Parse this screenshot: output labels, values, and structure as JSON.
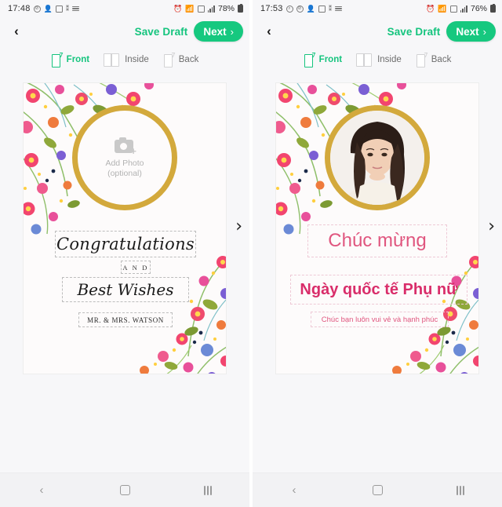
{
  "screens": [
    {
      "id": "front-template",
      "status_bar": {
        "time": "17:48",
        "battery": "78%",
        "icons_left": [
          "do-not-disturb-icon",
          "contacts-icon",
          "gallery-icon",
          "bluetooth-share-icon",
          "menu-lines-icon"
        ],
        "icons_right": [
          "alarm-icon",
          "wifi-icon",
          "data-saver-icon",
          "signal-bars-icon"
        ]
      },
      "app_bar": {
        "back_label": "‹",
        "save_draft_label": "Save Draft",
        "next_label": "Next",
        "next_chevron": "›"
      },
      "tabs": [
        {
          "label": "Front",
          "icon": "card-front-icon",
          "active": true
        },
        {
          "label": "Inside",
          "icon": "card-inside-icon",
          "active": false
        },
        {
          "label": "Back",
          "icon": "card-back-icon",
          "active": false
        }
      ],
      "card": {
        "photo_placeholder": {
          "icon": "add-photo-camera-icon",
          "line1": "Add Photo",
          "line2": "(optional)",
          "has_photo": false
        },
        "text_blocks": [
          {
            "name": "greeting",
            "text": "Congratulations"
          },
          {
            "name": "connector",
            "text": "A N D"
          },
          {
            "name": "subgreeting",
            "text": "Best Wishes"
          },
          {
            "name": "signature",
            "text": "MR. & MRS. WATSON"
          }
        ]
      },
      "carousel_next": "›",
      "nav_bar": {
        "back": "‹",
        "home": "home-square-icon",
        "recents": "recents-icon"
      }
    },
    {
      "id": "womens-day-template",
      "status_bar": {
        "time": "17:53",
        "battery": "76%",
        "icons_left": [
          "search-icon",
          "do-not-disturb-icon",
          "contacts-icon",
          "gallery-icon",
          "bluetooth-share-icon",
          "menu-lines-icon"
        ],
        "icons_right": [
          "alarm-icon",
          "wifi-icon",
          "data-saver-icon",
          "signal-bars-icon"
        ]
      },
      "app_bar": {
        "back_label": "‹",
        "save_draft_label": "Save Draft",
        "next_label": "Next",
        "next_chevron": "›"
      },
      "tabs": [
        {
          "label": "Front",
          "icon": "card-front-icon",
          "active": true
        },
        {
          "label": "Inside",
          "icon": "card-inside-icon",
          "active": false
        },
        {
          "label": "Back",
          "icon": "card-back-icon",
          "active": false
        }
      ],
      "card": {
        "photo_placeholder": {
          "icon": "portrait-photo",
          "line1": "",
          "line2": "",
          "has_photo": true
        },
        "text_blocks": [
          {
            "name": "greeting",
            "text": "Chúc mừng"
          },
          {
            "name": "occasion",
            "text": "Ngày quốc tế Phụ nữ"
          },
          {
            "name": "wish",
            "text": "Chúc bạn luôn vui vẻ và hạnh phúc"
          }
        ]
      },
      "carousel_next": "›",
      "nav_bar": {
        "back": "‹",
        "home": "home-square-icon",
        "recents": "recents-icon"
      }
    }
  ],
  "colors": {
    "accent_green": "#16c87f",
    "gold_ring": "#d3a93c",
    "pink_title": "#e0567f",
    "pink_bold": "#d92d6a",
    "card_bg": "#fdfbfb",
    "screen_bg": "#f7f7f9"
  }
}
